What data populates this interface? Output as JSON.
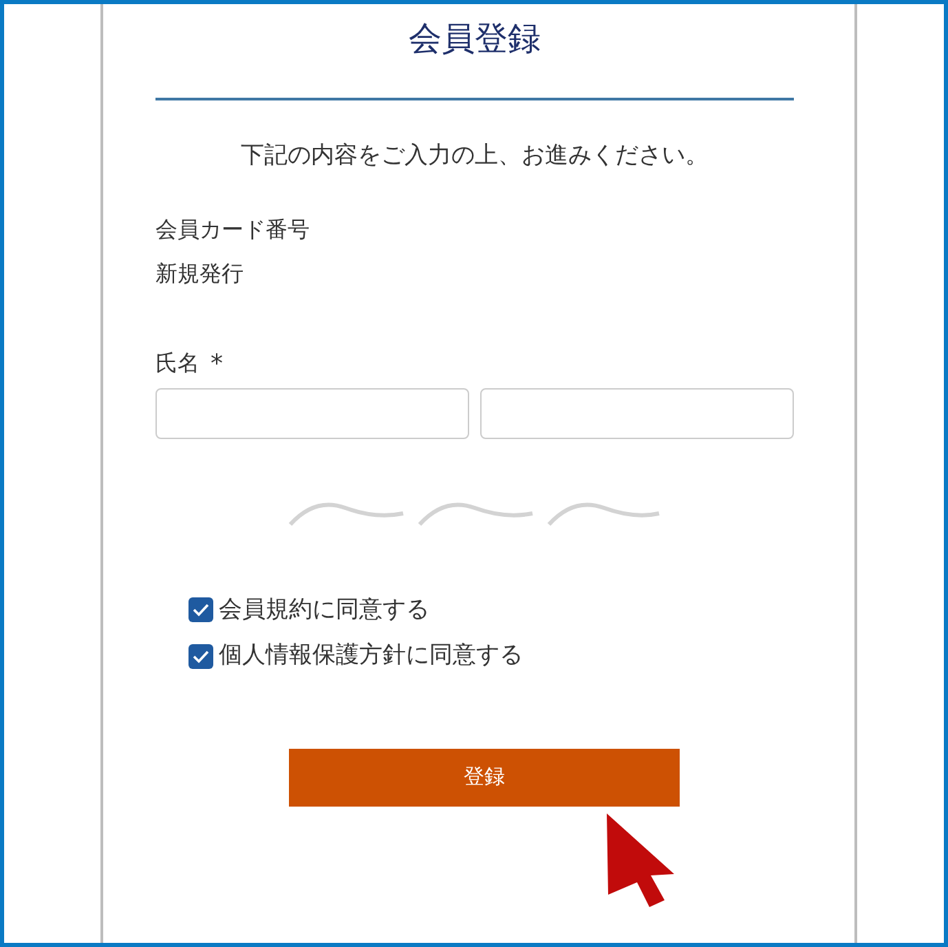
{
  "title": "会員登録",
  "instruction": "下記の内容をご入力の上、お進みください。",
  "member_card": {
    "label": "会員カード番号",
    "value": "新規発行"
  },
  "name_field": {
    "label": "氏名",
    "required_mark": "*"
  },
  "agreements": [
    {
      "label": "会員規約に同意する",
      "checked": true
    },
    {
      "label": "個人情報保護方針に同意する",
      "checked": true
    }
  ],
  "submit_button": "登録"
}
